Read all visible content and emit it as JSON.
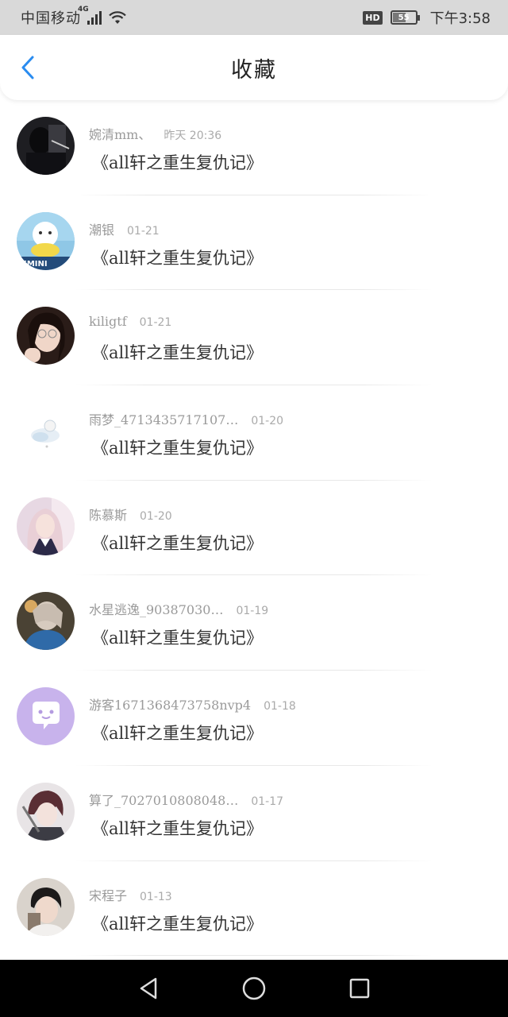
{
  "status_bar": {
    "carrier": "中国移动",
    "network": "4G",
    "hd": "HD",
    "battery": "55",
    "time": "下午3:58"
  },
  "header": {
    "title": "收藏"
  },
  "favorites": [
    {
      "user": "婉清mm、",
      "time": "昨天 20:36",
      "book": "《all轩之重生复仇记》",
      "avatar": "avatar-dark-photo"
    },
    {
      "user": "潮银",
      "time": "01-21",
      "book": "《all轩之重生复仇记》",
      "avatar": "avatar-gemini-cartoon"
    },
    {
      "user": "kiligtf",
      "time": "01-21",
      "book": "《all轩之重生复仇记》",
      "avatar": "avatar-girl-glasses"
    },
    {
      "user": "雨梦_4713435717107…",
      "time": "01-20",
      "book": "《all轩之重生复仇记》",
      "avatar": "avatar-sleeping-cat"
    },
    {
      "user": "陈慕斯",
      "time": "01-20",
      "book": "《all轩之重生复仇记》",
      "avatar": "avatar-girl-pink"
    },
    {
      "user": "水星逃逸_90387030…",
      "time": "01-19",
      "book": "《all轩之重生复仇记》",
      "avatar": "avatar-girl-blue"
    },
    {
      "user": "游客1671368473758nvp4",
      "time": "01-18",
      "book": "《all轩之重生复仇记》",
      "avatar": "avatar-chat-bubble"
    },
    {
      "user": "算了_7027010808048…",
      "time": "01-17",
      "book": "《all轩之重生复仇记》",
      "avatar": "avatar-anime-boy"
    },
    {
      "user": "宋程子",
      "time": "01-13",
      "book": "《all轩之重生复仇记》",
      "avatar": "avatar-boy-portrait"
    }
  ],
  "colors": {
    "accent": "#2a8cf0",
    "status_bar_bg": "#d9d9d9",
    "nav_bar_bg": "#000000",
    "meta_text": "#9a9a9a"
  },
  "icons": {
    "back": "chevron-left-icon",
    "nav_back": "triangle-back-icon",
    "nav_home": "circle-home-icon",
    "nav_recents": "square-recents-icon"
  }
}
